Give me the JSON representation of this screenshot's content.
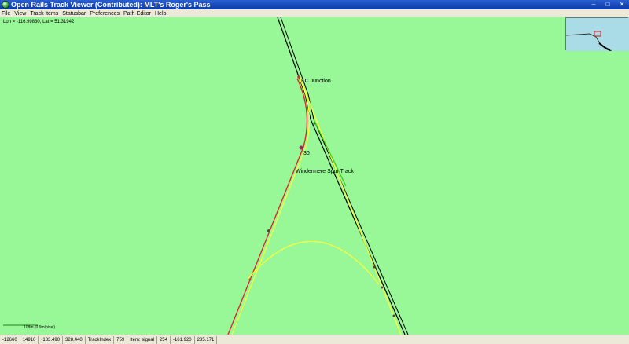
{
  "window": {
    "title": "Open Rails Track Viewer (Contributed): MLT's Roger's Pass",
    "controls": {
      "minimize": "–",
      "maximize": "□",
      "close": "✕"
    }
  },
  "menu": [
    {
      "label": "File"
    },
    {
      "label": "View"
    },
    {
      "label": "Track items"
    },
    {
      "label": "Statusbar"
    },
    {
      "label": "Preferences"
    },
    {
      "label": "Path-Editor"
    },
    {
      "label": "Help"
    }
  ],
  "canvas": {
    "coordinates": "Lon = -116.99830, Lat = 51.31942",
    "labels": {
      "junction": "KC Junction",
      "number": "30",
      "track_name": "Windermere Spur Track"
    },
    "scale_text": "108m (0.9m/pixel)"
  },
  "colors": {
    "background": "#98f898",
    "track_main": "#000000",
    "track_yellow": "#ffff33",
    "track_red": "#e02020",
    "minimap_water": "#a9dce6"
  },
  "statusbar": [
    {
      "value": "-12660"
    },
    {
      "value": "14910"
    },
    {
      "value": "-183.490"
    },
    {
      "value": "328.440"
    },
    {
      "value": "TrackIndex"
    },
    {
      "value": "759"
    },
    {
      "value": "Item: signal"
    },
    {
      "value": "254"
    },
    {
      "value": "-161.920"
    },
    {
      "value": "285.171"
    }
  ]
}
